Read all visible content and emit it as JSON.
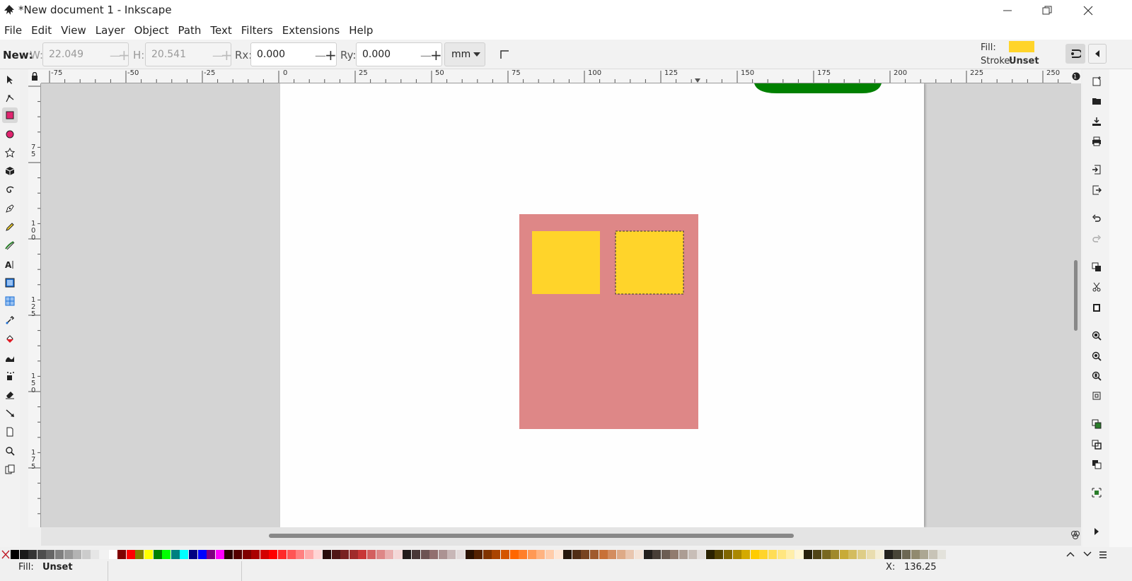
{
  "window": {
    "title": "*New document 1 - Inkscape"
  },
  "menu": [
    "File",
    "Edit",
    "View",
    "Layer",
    "Object",
    "Path",
    "Text",
    "Filters",
    "Extensions",
    "Help"
  ],
  "tool_controls": {
    "new_label": "New:",
    "w_label": "W:",
    "w_value": "22.049",
    "h_label": "H:",
    "h_value": "20.541",
    "rx_label": "Rx:",
    "rx_value": "0.000",
    "ry_label": "Ry:",
    "ry_value": "0.000",
    "unit": "mm"
  },
  "style_indicator": {
    "fill_label": "Fill:",
    "fill_color": "#ffd42a",
    "stroke_label": "Stroke:",
    "stroke_value": "Unset"
  },
  "ruler_top_labels": [
    "-75",
    "-50",
    "-25",
    "0",
    "25",
    "50",
    "75",
    "100",
    "125",
    "150",
    "175",
    "200",
    "225",
    "250"
  ],
  "ruler_left_labels": [
    "7\n5",
    "1\n0\n0",
    "1\n2\n5",
    "1\n5\n0",
    "1\n7\n5"
  ],
  "canvas": {
    "large_rect_color": "#de8787",
    "small_rect_color": "#ffd42a",
    "green_shape_color": "#008000"
  },
  "status": {
    "fill_label": "Fill:",
    "fill_value": "Unset",
    "coord_label": "X:",
    "coord_value": "136.25"
  },
  "palette_colors": [
    "#000000",
    "#1a1a1a",
    "#333333",
    "#4d4d4d",
    "#666666",
    "#808080",
    "#999999",
    "#b3b3b3",
    "#cccccc",
    "#e6e6e6",
    "#f2f2f2",
    "#ffffff",
    "#800000",
    "#ff0000",
    "#808000",
    "#ffff00",
    "#008000",
    "#00ff00",
    "#008080",
    "#00ffff",
    "#000080",
    "#0000ff",
    "#800080",
    "#ff00ff",
    "#2b0000",
    "#550000",
    "#800000",
    "#aa0000",
    "#d40000",
    "#ff0000",
    "#ff2a2a",
    "#ff5555",
    "#ff8080",
    "#ffaaaa",
    "#ffd5d5",
    "#280b0b",
    "#501616",
    "#782121",
    "#a02c2c",
    "#c83737",
    "#d35f5f",
    "#de8787",
    "#e9afaf",
    "#f4d7d7",
    "#241c1c",
    "#483737",
    "#6c5353",
    "#916f6f",
    "#ac9393",
    "#c8b7b7",
    "#e3dbdb",
    "#2b1100",
    "#552200",
    "#803300",
    "#aa4400",
    "#d45500",
    "#ff6600",
    "#ff7f2a",
    "#ff9955",
    "#ffb380",
    "#ffccaa",
    "#ffe6d5",
    "#28170b",
    "#502d16",
    "#784421",
    "#a05a2c",
    "#c87137",
    "#d38d5f",
    "#deaa87",
    "#e9c6af",
    "#f4e3d7",
    "#241f1c",
    "#483e37",
    "#6c5d53",
    "#917c6f",
    "#ac9d93",
    "#c8beb7",
    "#e3dedb",
    "#2b2200",
    "#554400",
    "#806600",
    "#aa8800",
    "#d4aa00",
    "#ffcc00",
    "#ffd42a",
    "#ffdd55",
    "#ffe680",
    "#ffeeaa",
    "#fff6d5",
    "#28220b",
    "#504416",
    "#786721",
    "#a0892c",
    "#c8ab37",
    "#d3bc5f",
    "#decd87",
    "#e9ddaf",
    "#f4eed7",
    "#24221c",
    "#484537",
    "#6c6753",
    "#918a6f",
    "#aca793",
    "#c8c4b7",
    "#e3e2db"
  ]
}
